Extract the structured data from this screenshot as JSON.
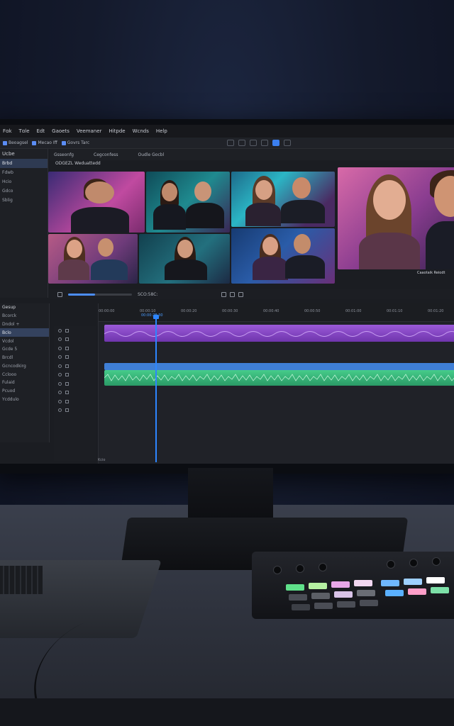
{
  "app": {
    "menu": [
      "Fɑk",
      "Tɑle",
      "Edt",
      "Gaoets",
      "Veemaner",
      "Hitpde",
      "Wcnds",
      "Help"
    ],
    "toolbar": {
      "item1": "Beoagsel",
      "item2": "Mecao Iff",
      "item3": "Govrs Tarc"
    }
  },
  "media_panel": {
    "title": "Ucbe",
    "items": [
      "Brbd",
      "Fdwb",
      "Hcio",
      "Gdco",
      "Sblig"
    ]
  },
  "viewer": {
    "header": [
      "Gsseonfg",
      "Cegconfess",
      "Oudle Gocbl"
    ],
    "source_label": "ODGEZL Weduattedd",
    "program_label": "Caaotaik Reiodt",
    "transport_time": "SCO:58C:"
  },
  "timeline": {
    "timecode": "00:00:28:30",
    "ruler": [
      "00:00:00",
      "00:00:10",
      "00:00:20",
      "00:00:30",
      "00:00:40",
      "00:00:50",
      "00:01:00",
      "00:01:10",
      "00:01:20"
    ],
    "status": "Kcio"
  },
  "project_panel": {
    "header": "Gesup",
    "items": [
      "Bcorck",
      "Dndol +",
      "Bclo",
      "Vcdol",
      "Gcde 5",
      "Brcdl",
      "Gcncodkirg",
      "Cclooo",
      "Fulaid",
      "Pcuod",
      "Ycddulo"
    ]
  },
  "colors": {
    "accent": "#2d86ff",
    "audio_purple": "#8f4dd1",
    "audio_green": "#38b97a",
    "video_blue": "#3f7fd6"
  }
}
